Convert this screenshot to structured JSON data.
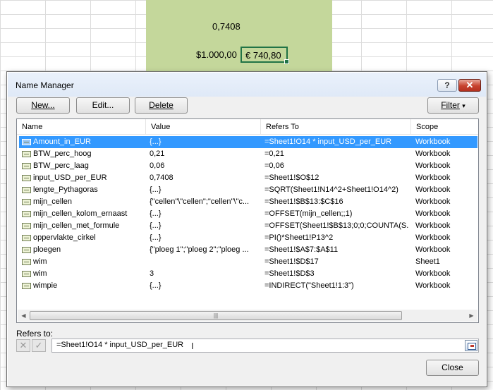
{
  "sheet": {
    "value_top": "0,7408",
    "value_usd": "$1.000,00",
    "value_eur": "€  740,80"
  },
  "dialog": {
    "title": "Name Manager",
    "help_label": "?",
    "close_x": "✕",
    "buttons": {
      "new": "New...",
      "edit": "Edit...",
      "delete": "Delete",
      "filter": "Filter",
      "filter_arrow": "▾",
      "close": "Close"
    },
    "columns": [
      "Name",
      "Value",
      "Refers To",
      "Scope"
    ],
    "rows": [
      {
        "name": "Amount_in_EUR",
        "value": "{...}",
        "refers_to": "=Sheet1!O14 * input_USD_per_EUR",
        "scope": "Workbook",
        "selected": true
      },
      {
        "name": "BTW_perc_hoog",
        "value": "0,21",
        "refers_to": "=0,21",
        "scope": "Workbook"
      },
      {
        "name": "BTW_perc_laag",
        "value": "0,06",
        "refers_to": "=0,06",
        "scope": "Workbook"
      },
      {
        "name": "input_USD_per_EUR",
        "value": "0,7408",
        "refers_to": "=Sheet1!$O$12",
        "scope": "Workbook"
      },
      {
        "name": "lengte_Pythagoras",
        "value": "{...}",
        "refers_to": "=SQRT(Sheet1!N14^2+Sheet1!O14^2)",
        "scope": "Workbook"
      },
      {
        "name": "mijn_cellen",
        "value": "{\"cellen\"\\\"cellen\";\"cellen\"\\\"c...",
        "refers_to": "=Sheet1!$B$13:$C$16",
        "scope": "Workbook"
      },
      {
        "name": "mijn_cellen_kolom_ernaast",
        "value": "{...}",
        "refers_to": "=OFFSET(mijn_cellen;;1)",
        "scope": "Workbook"
      },
      {
        "name": "mijn_cellen_met_formule",
        "value": "{...}",
        "refers_to": "=OFFSET(Sheet1!$B$13;0;0;COUNTA(S...",
        "scope": "Workbook"
      },
      {
        "name": "oppervlakte_cirkel",
        "value": "{...}",
        "refers_to": "=PI()*Sheet1!P13^2",
        "scope": "Workbook"
      },
      {
        "name": "ploegen",
        "value": "{\"ploeg 1\";\"ploeg 2\";\"ploeg ...",
        "refers_to": "=Sheet1!$A$7:$A$11",
        "scope": "Workbook"
      },
      {
        "name": "wim",
        "value": "",
        "refers_to": "=Sheet1!$D$17",
        "scope": "Sheet1"
      },
      {
        "name": "wim",
        "value": "3",
        "refers_to": "=Sheet1!$D$3",
        "scope": "Workbook"
      },
      {
        "name": "wimpie",
        "value": "{...}",
        "refers_to": "=INDIRECT(\"Sheet1!1:3\")",
        "scope": "Workbook"
      }
    ],
    "scroll": {
      "left_arrow": "◀",
      "right_arrow": "▶",
      "grip": "|||"
    },
    "refers_label": "Refers to:",
    "cancel_icon": "✕",
    "confirm_icon": "✓",
    "refers_value": "=Sheet1!O14 * input_USD_per_EUR",
    "text_caret": "I"
  }
}
